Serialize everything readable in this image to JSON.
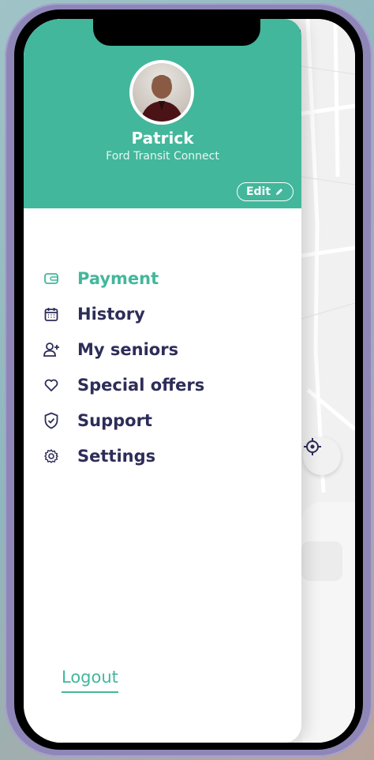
{
  "profile": {
    "name": "Patrick",
    "vehicle": "Ford Transit Connect",
    "edit_label": "Edit"
  },
  "menu": {
    "items": [
      {
        "label": "Payment",
        "icon": "wallet-icon",
        "active": true
      },
      {
        "label": "History",
        "icon": "calendar-icon",
        "active": false
      },
      {
        "label": "My seniors",
        "icon": "user-plus-icon",
        "active": false
      },
      {
        "label": "Special offers",
        "icon": "heart-icon",
        "active": false
      },
      {
        "label": "Support",
        "icon": "shield-check-icon",
        "active": false
      },
      {
        "label": "Settings",
        "icon": "gear-icon",
        "active": false
      }
    ]
  },
  "logout_label": "Logout",
  "colors": {
    "accent": "#42b79b",
    "text_dark": "#2d2d59",
    "phone_frame": "#8f86b8"
  }
}
